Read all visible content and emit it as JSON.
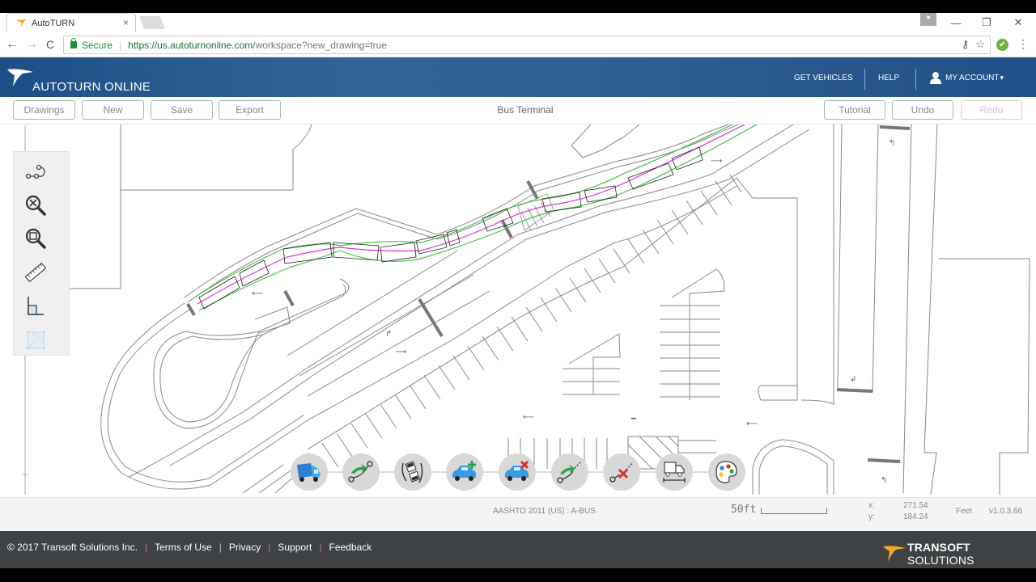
{
  "browser": {
    "tab_title": "AutoTURN",
    "tab_close": "×",
    "secure_label": "Secure",
    "url_host": "https://us.autoturnonline.com",
    "url_path": "/workspace?new_drawing=true",
    "icons": {
      "back": "back-arrow-icon",
      "forward": "forward-arrow-icon",
      "reload": "reload-icon",
      "lock": "lock-icon",
      "key": "key-icon",
      "star": "bookmark-star-icon",
      "extension": "checkmark-extension-icon",
      "menu": "kebab-menu-icon"
    },
    "glyphs": {
      "back": "←",
      "forward": "→",
      "reload": "C",
      "key": "⚷",
      "star": "☆",
      "check": "✔",
      "menu": "⋮",
      "minimize": "—",
      "restore": "❐",
      "close": "✕",
      "profile": "👤"
    }
  },
  "header": {
    "logo_text": "AUTOTURN ONLINE",
    "nav": [
      {
        "label": "GET VEHICLES"
      },
      {
        "label": "HELP"
      },
      {
        "label": "MY ACCOUNT",
        "caret": "▾"
      }
    ]
  },
  "toolbar": {
    "left_buttons": [
      {
        "label": "Drawings"
      },
      {
        "label": "New"
      },
      {
        "label": "Save"
      },
      {
        "label": "Export"
      }
    ],
    "drawing_title": "Bus Terminal",
    "right_buttons": [
      {
        "label": "Tutorial",
        "enabled": true
      },
      {
        "label": "Undo",
        "enabled": true
      },
      {
        "label": "Redo",
        "enabled": false
      }
    ]
  },
  "side_tools": [
    {
      "name": "path-edit-icon",
      "enabled": true
    },
    {
      "name": "zoom-extents-icon",
      "enabled": true
    },
    {
      "name": "zoom-window-icon",
      "enabled": true
    },
    {
      "name": "measure-ruler-icon",
      "enabled": true
    },
    {
      "name": "orthogonal-angle-icon",
      "enabled": true
    },
    {
      "name": "fit-selection-icon",
      "enabled": false
    }
  ],
  "vehicle_tools": [
    {
      "name": "select-vehicle-icon"
    },
    {
      "name": "arc-path-icon"
    },
    {
      "name": "autoforward-path-icon"
    },
    {
      "name": "add-vehicle-icon"
    },
    {
      "name": "delete-vehicle-icon"
    },
    {
      "name": "continue-path-icon"
    },
    {
      "name": "delete-path-icon"
    },
    {
      "name": "vehicle-dimensions-icon"
    },
    {
      "name": "color-palette-icon"
    }
  ],
  "status": {
    "vehicle": "AASHTO 2011 (US) : A-BUS",
    "scale_label": "50ft",
    "x_label": "x:",
    "x_value": "271.54",
    "y_label": "y:",
    "y_value": "184.24",
    "units": "Feet",
    "version": "v1.0.3.66"
  },
  "footer": {
    "copyright": "© 2017 Transoft Solutions Inc.",
    "links": [
      {
        "label": "Terms of Use"
      },
      {
        "label": "Privacy"
      },
      {
        "label": "Support"
      },
      {
        "label": "Feedback"
      }
    ],
    "brand_bold": "TRANSOFT",
    "brand_light": " SOLUTIONS"
  },
  "colors": {
    "header_blue": "#1d4d86",
    "swept_path_green": "#3fc43f",
    "path_magenta": "#d633d6",
    "footer_bg": "#3e4244",
    "brand_orange": "#f5a623"
  }
}
